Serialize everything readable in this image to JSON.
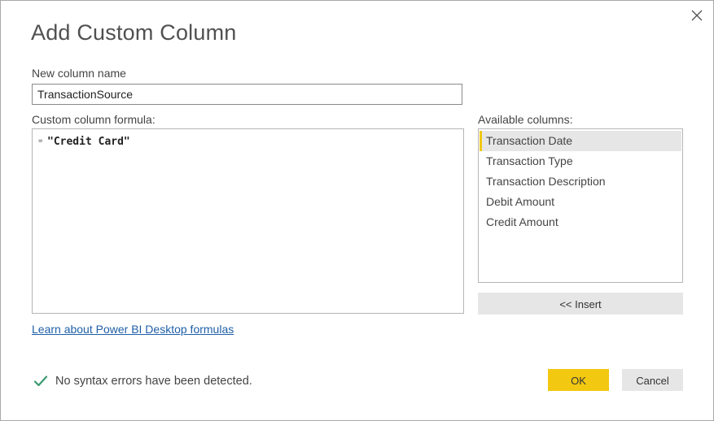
{
  "dialog": {
    "title": "Add Custom Column",
    "close_icon": "close-icon"
  },
  "new_column": {
    "label": "New column name",
    "value": "TransactionSource"
  },
  "formula": {
    "label": "Custom column formula:",
    "prefix": "=",
    "text": "\"Credit Card\""
  },
  "available_columns": {
    "label": "Available columns:",
    "items": [
      {
        "label": "Transaction Date",
        "selected": true
      },
      {
        "label": "Transaction Type",
        "selected": false
      },
      {
        "label": "Transaction Description",
        "selected": false
      },
      {
        "label": "Debit Amount",
        "selected": false
      },
      {
        "label": "Credit Amount",
        "selected": false
      }
    ],
    "insert_label": "<< Insert"
  },
  "learn_link": "Learn about Power BI Desktop formulas",
  "status": {
    "icon": "checkmark-icon",
    "text": "No syntax errors have been detected."
  },
  "buttons": {
    "ok": "OK",
    "cancel": "Cancel"
  },
  "colors": {
    "accent": "#f2c811",
    "success": "#3a9a6e",
    "link": "#1f5fa8",
    "button_bg": "#e6e6e6"
  }
}
